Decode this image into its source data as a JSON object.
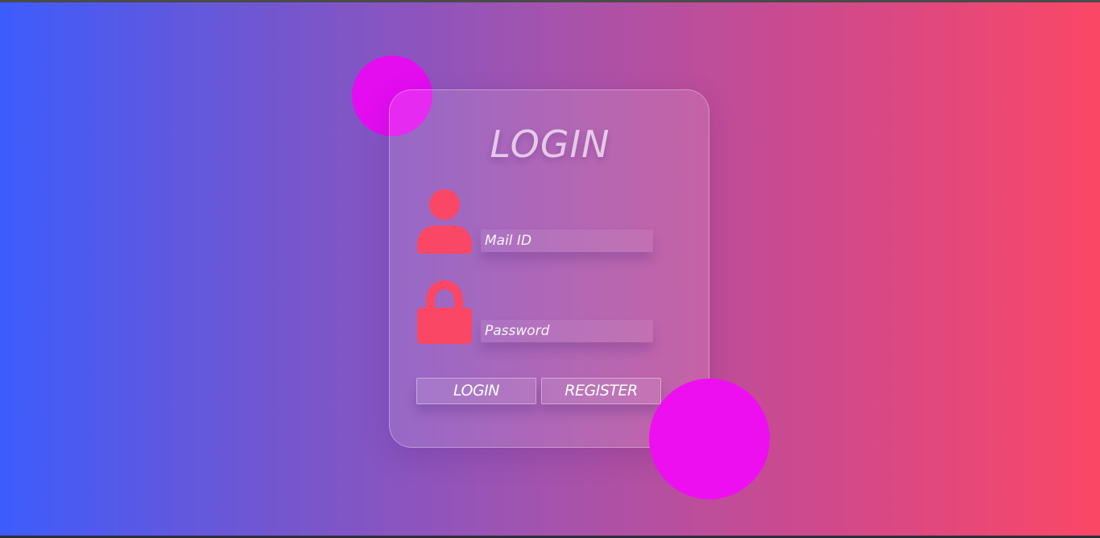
{
  "login_form": {
    "title": "LOGIN",
    "fields": {
      "mail": {
        "placeholder": "Mail ID",
        "icon": "user-icon"
      },
      "password": {
        "placeholder": "Password",
        "icon": "lock-icon"
      }
    },
    "buttons": {
      "login_label": "LOGIN",
      "register_label": "REGISTER"
    }
  },
  "colors": {
    "gradient_start": "#3d5cfc",
    "gradient_end": "#fb4766",
    "accent_circle": "#ee0ff0",
    "icon_color": "#fb4766"
  }
}
